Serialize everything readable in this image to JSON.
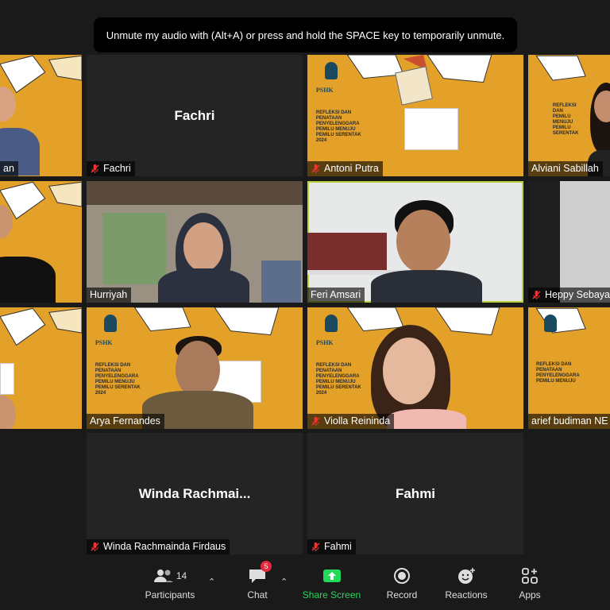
{
  "notice": "Unmute my audio with (Alt+A) or press and hold the SPACE key to temporarily unmute.",
  "poster": {
    "brand": "PSHK",
    "title_lines": [
      "REFLEKSI DAN",
      "PENATAAN",
      "PENYELENGGARA",
      "PEMILU MENUJU",
      "PEMILU SERENTAK",
      "2024"
    ]
  },
  "participants": {
    "r1c0": "an",
    "fachri": "Fachri",
    "fachri_big": "Fachri",
    "antoni": "Antoni Putra",
    "alviani": "Alviani Sabillah",
    "hurriyah": "Hurriyah",
    "feri": "Feri Amsari",
    "heppy": "Heppy Sebaya",
    "arya": "Arya Fernandes",
    "violla": "Violla Reininda",
    "arief": "arief budiman NE",
    "winda": "Winda Rachmainda Firdaus",
    "winda_big": "Winda  Rachmai...",
    "fahmi": "Fahmi",
    "fahmi_big": "Fahmi"
  },
  "toolbar": {
    "participants_label": "Participants",
    "participants_count": "14",
    "chat_label": "Chat",
    "chat_badge": "5",
    "share_label": "Share Screen",
    "record_label": "Record",
    "reactions_label": "Reactions",
    "apps_label": "Apps"
  },
  "colors": {
    "poster": "#e4a129",
    "active_border": "#b7d33d",
    "share_green": "#23d959",
    "badge_red": "#e6283a"
  }
}
